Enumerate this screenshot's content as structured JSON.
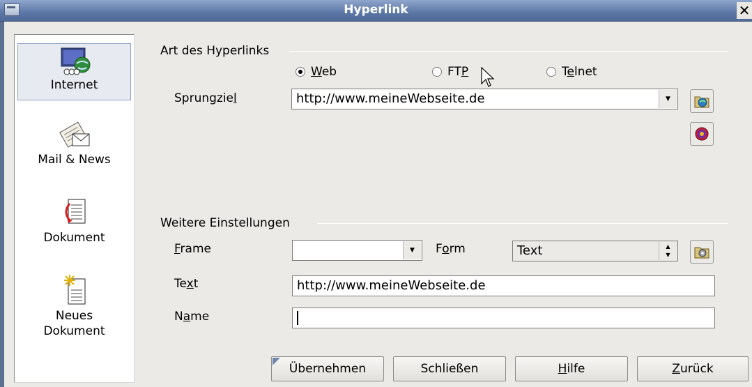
{
  "window": {
    "title": "Hyperlink",
    "close_label": "✕"
  },
  "sidebar": {
    "items": [
      {
        "label": "Internet",
        "icon": "internet-globe-icon",
        "selected": true
      },
      {
        "label": "Mail & News",
        "icon": "mail-envelope-icon",
        "selected": false
      },
      {
        "label": "Dokument",
        "icon": "document-icon",
        "selected": false
      },
      {
        "label_line1": "Neues",
        "label_line2": "Dokument",
        "icon": "new-document-icon",
        "selected": false
      }
    ]
  },
  "hyperlink_type": {
    "title": "Art des Hyperlinks",
    "options": [
      {
        "pre": "",
        "mn": "W",
        "post": "eb",
        "selected": true
      },
      {
        "pre": "FT",
        "mn": "P",
        "post": "",
        "selected": false
      },
      {
        "pre": "T",
        "mn": "e",
        "post": "lnet",
        "selected": false
      }
    ],
    "target_label_pre": "Sprungzie",
    "target_label_mn": "l",
    "target_value": "http://www.meineWebseite.de"
  },
  "further_settings": {
    "title": "Weitere Einstellungen",
    "frame_label_mn": "F",
    "frame_label_post": "rame",
    "frame_value": "",
    "form_label_pre": "F",
    "form_label_mn": "o",
    "form_label_post": "rm",
    "form_value": "Text",
    "text_label_pre": "Te",
    "text_label_mn": "x",
    "text_label_post": "t",
    "text_value": "http://www.meineWebseite.de",
    "name_label_pre": "N",
    "name_label_mn": "a",
    "name_label_post": "me",
    "name_value": ""
  },
  "buttons": {
    "apply": "Übernehmen",
    "close": "Schließen",
    "help_mn": "H",
    "help_post": "ilfe",
    "back_mn": "Z",
    "back_post": "urück"
  },
  "colors": {
    "titlebar": "#5c77a6",
    "dialog_bg": "#eceae6",
    "selection": "#8fa0bf"
  }
}
